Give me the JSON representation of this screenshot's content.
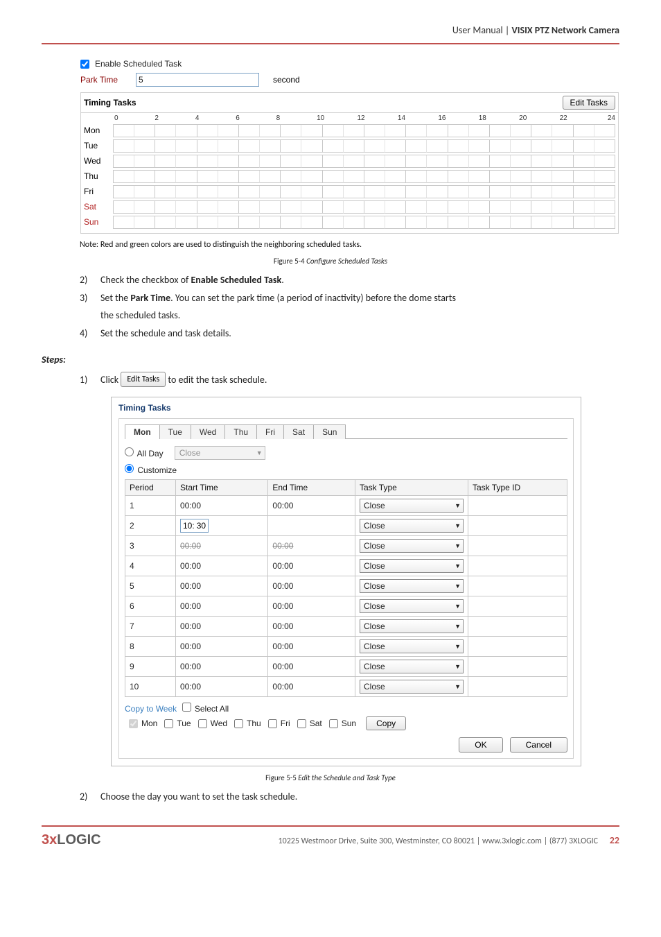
{
  "header": {
    "pre": "User Manual ",
    "sep": "| ",
    "brand": "VISIX PTZ Network Camera"
  },
  "scheduled_panel": {
    "enable_label": "Enable Scheduled Task",
    "park_label": "Park Time",
    "park_value": "5",
    "second_label": "second",
    "timing_title": "Timing Tasks",
    "edit_tasks_btn": "Edit Tasks",
    "hours": [
      "0",
      "2",
      "4",
      "6",
      "8",
      "10",
      "12",
      "14",
      "16",
      "18",
      "20",
      "22",
      "24"
    ],
    "days": [
      {
        "label": "Mon",
        "weekend": false
      },
      {
        "label": "Tue",
        "weekend": false
      },
      {
        "label": "Wed",
        "weekend": false
      },
      {
        "label": "Thu",
        "weekend": false
      },
      {
        "label": "Fri",
        "weekend": false
      },
      {
        "label": "Sat",
        "weekend": true
      },
      {
        "label": "Sun",
        "weekend": true
      }
    ]
  },
  "note": "Note: Red and green colors are used to distinguish the neighboring scheduled tasks.",
  "fig1": {
    "prefix": "Figure 5-4",
    "title": "Configure Scheduled Tasks"
  },
  "list_items": {
    "i2_num": "2)",
    "i2_a": "Check the checkbox of ",
    "i2_b": "Enable Scheduled Task",
    "i2_c": ".",
    "i3_num": "3)",
    "i3_a": "Set the ",
    "i3_b": "Park Time",
    "i3_c": ". You can set the park time (a period of inactivity) before the dome starts",
    "i3_d": "the scheduled tasks.",
    "i4_num": "4)",
    "i4_a": "Set the schedule and task details."
  },
  "steps_hd": "Steps:",
  "step1": {
    "num": "1)",
    "a": "Click ",
    "btn": "Edit Tasks",
    "b": " to edit the task schedule."
  },
  "dialog": {
    "title": "Timing Tasks",
    "tabs": [
      "Mon",
      "Tue",
      "Wed",
      "Thu",
      "Fri",
      "Sat",
      "Sun"
    ],
    "allday": "All Day",
    "allday_select": "Close",
    "customize": "Customize",
    "cols": {
      "period": "Period",
      "start": "Start Time",
      "end": "End Time",
      "type": "Task Type",
      "typeid": "Task Type ID"
    },
    "rows": [
      {
        "p": "1",
        "s": "00:00",
        "e": "00:00",
        "t": "Close"
      },
      {
        "p": "2",
        "s_h": "10",
        "s_m": "30",
        "e": "",
        "t": "Close",
        "editing": true
      },
      {
        "p": "3",
        "s": "00:00",
        "e": "00:00",
        "t": "Close",
        "strike": true
      },
      {
        "p": "4",
        "s": "00:00",
        "e": "00:00",
        "t": "Close"
      },
      {
        "p": "5",
        "s": "00:00",
        "e": "00:00",
        "t": "Close"
      },
      {
        "p": "6",
        "s": "00:00",
        "e": "00:00",
        "t": "Close"
      },
      {
        "p": "7",
        "s": "00:00",
        "e": "00:00",
        "t": "Close"
      },
      {
        "p": "8",
        "s": "00:00",
        "e": "00:00",
        "t": "Close"
      },
      {
        "p": "9",
        "s": "00:00",
        "e": "00:00",
        "t": "Close"
      },
      {
        "p": "10",
        "s": "00:00",
        "e": "00:00",
        "t": "Close"
      }
    ],
    "copy_link": "Copy to Week",
    "select_all": "Select All",
    "copy_days": [
      "Mon",
      "Tue",
      "Wed",
      "Thu",
      "Fri",
      "Sat",
      "Sun"
    ],
    "copy_btn": "Copy",
    "ok": "OK",
    "cancel": "Cancel"
  },
  "fig2": {
    "prefix": "Figure 5-5",
    "title": "Edit the Schedule and Task Type"
  },
  "closing": {
    "num": "2)",
    "text": "Choose the day you want to set the task schedule."
  },
  "footer": {
    "logo_three": "3",
    "logo_x": "x",
    "logo_rest": "LOGIC",
    "addr": "10225 Westmoor Drive, Suite 300, Westminster, CO 80021 | www.3xlogic.com | (877) 3XLOGIC",
    "page": "22"
  }
}
